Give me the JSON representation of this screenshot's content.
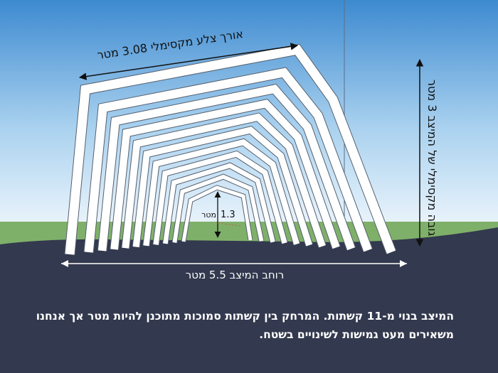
{
  "annotations": {
    "max_side_length": "אורך צלע מקסימלי 3.08 מטר",
    "max_height": "גובה מקסימלי של המיצב 3 מטר",
    "installation_width": "רוחב המיצב 5.5 מטר",
    "inner_height_value": "1.3",
    "inner_height_unit": "מטר"
  },
  "caption": {
    "line1": "המיצב בנוי מ-11 קשתות. המרחק בין קשתות סמוכות מתוכנן להיות מטר אך אנחנו",
    "line2": "משאירים מעט גמישות לשינויים בשטח."
  },
  "colors": {
    "sky_top": "#3d8ad0",
    "sky_bottom": "#e9f4fc",
    "grass": "#7fb069",
    "ground": "#33394e",
    "arch": "#ffffff",
    "arrow": "#111111"
  }
}
